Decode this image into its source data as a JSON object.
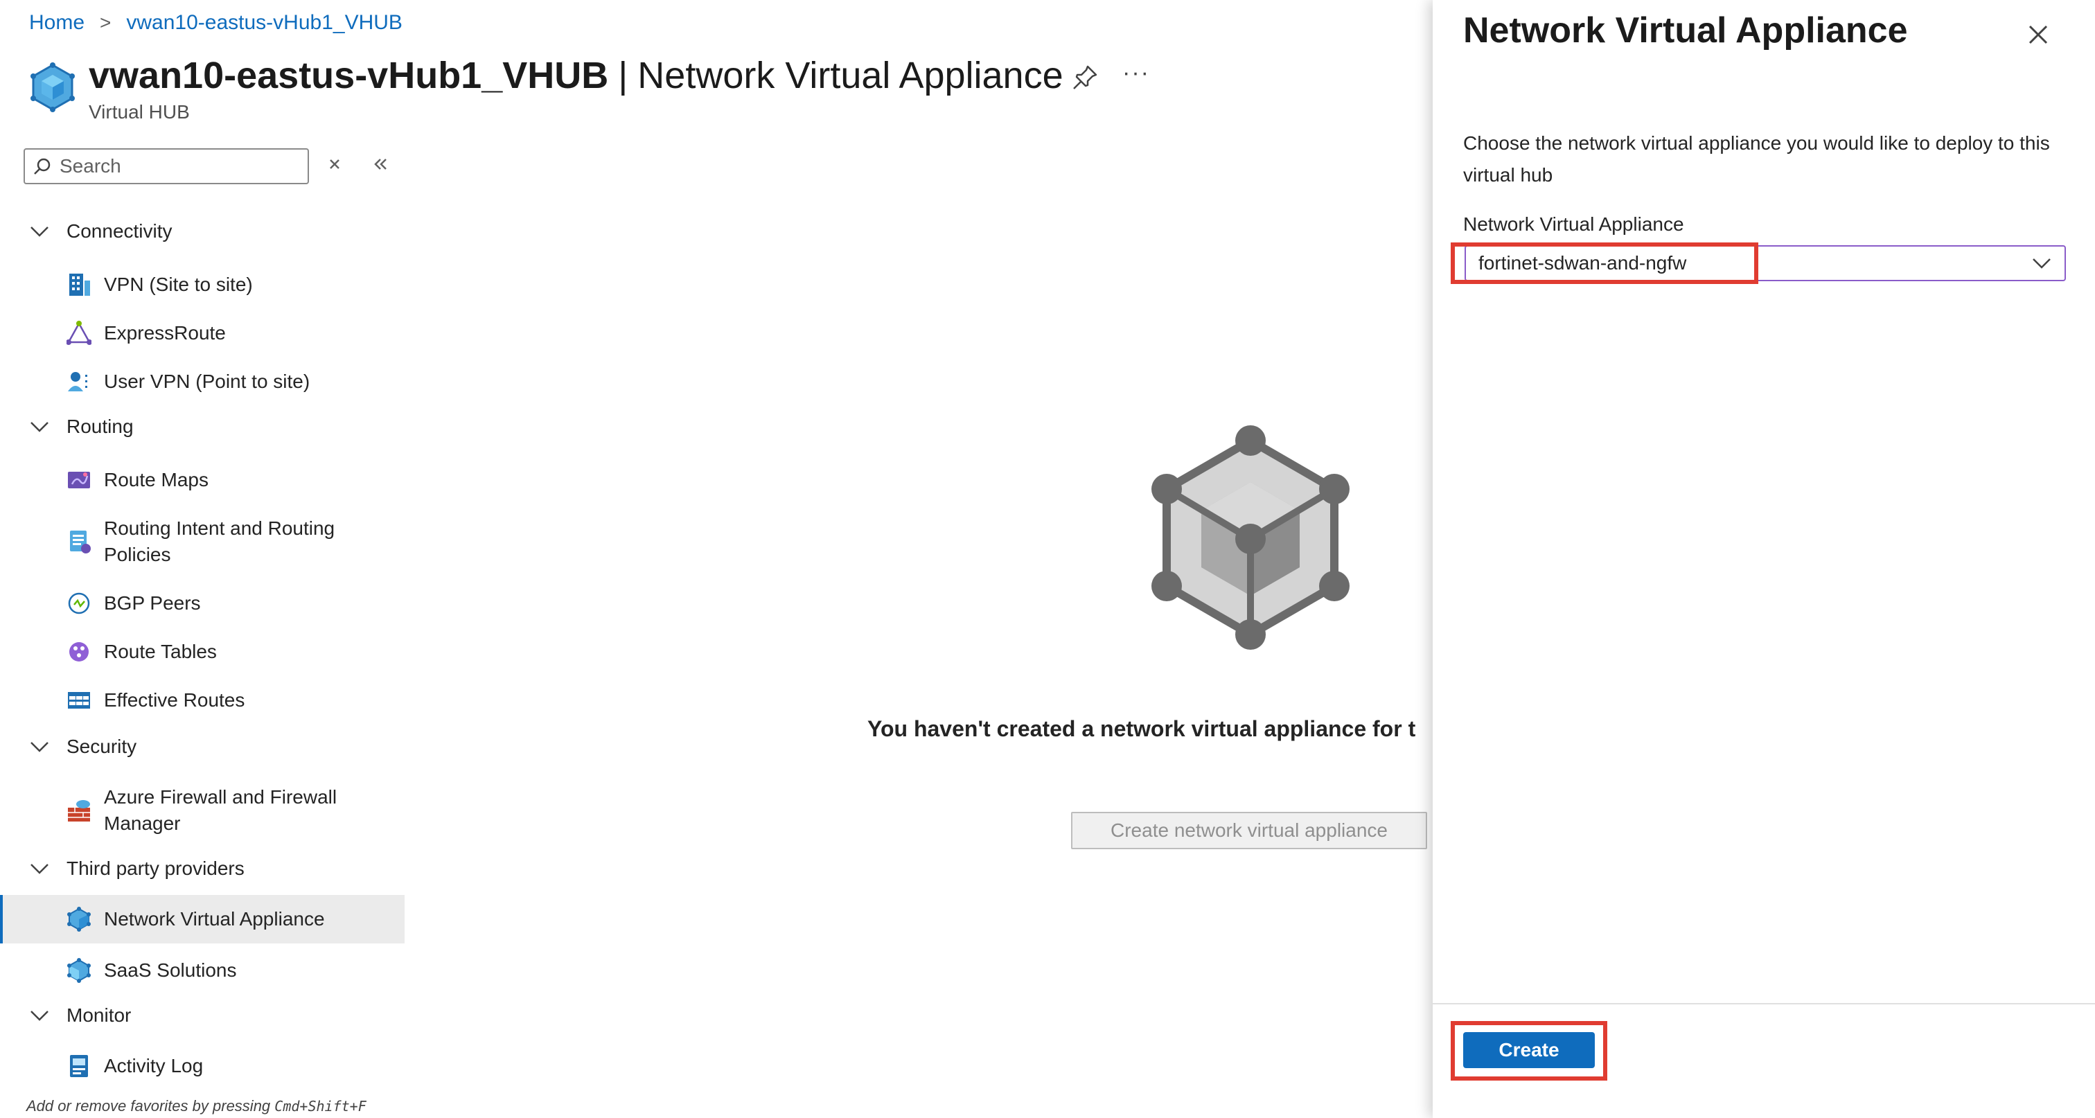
{
  "breadcrumb": {
    "home": "Home",
    "hub": "vwan10-eastus-vHub1_VHUB"
  },
  "header": {
    "resource_name": "vwan10-eastus-vHub1_VHUB",
    "separator": "|",
    "page_name": "Network Virtual Appliance",
    "subtitle": "Virtual HUB",
    "more": "···"
  },
  "search": {
    "placeholder": "Search"
  },
  "sidebar": {
    "sections": {
      "connectivity": "Connectivity",
      "routing": "Routing",
      "security": "Security",
      "third_party": "Third party providers",
      "monitor": "Monitor"
    },
    "items": {
      "vpn_s2s": "VPN (Site to site)",
      "expressroute": "ExpressRoute",
      "user_vpn": "User VPN (Point to site)",
      "route_maps": "Route Maps",
      "routing_intent": "Routing Intent and Routing Policies",
      "bgp_peers": "BGP Peers",
      "route_tables": "Route Tables",
      "effective_routes": "Effective Routes",
      "azure_firewall": "Azure Firewall and Firewall Manager",
      "nva": "Network Virtual Appliance",
      "saas": "SaaS Solutions",
      "activity_log": "Activity Log"
    },
    "selected": "Network Virtual Appliance",
    "footer_hint_prefix": "Add or remove favorites by pressing ",
    "footer_hint_shortcut": "Cmd+Shift+F"
  },
  "main": {
    "empty_message": "You haven't created a network virtual appliance for t",
    "create_button": "Create network virtual appliance"
  },
  "panel": {
    "title": "Network Virtual Appliance",
    "description": "Choose the network virtual appliance you would like to deploy to this virtual hub",
    "field_label": "Network Virtual Appliance",
    "selected_value": "fortinet-sdwan-and-ngfw",
    "create_button": "Create"
  },
  "colors": {
    "accent": "#0f6cbd",
    "highlight": "#e03c31",
    "dropdown_border": "#8a5cc9"
  }
}
